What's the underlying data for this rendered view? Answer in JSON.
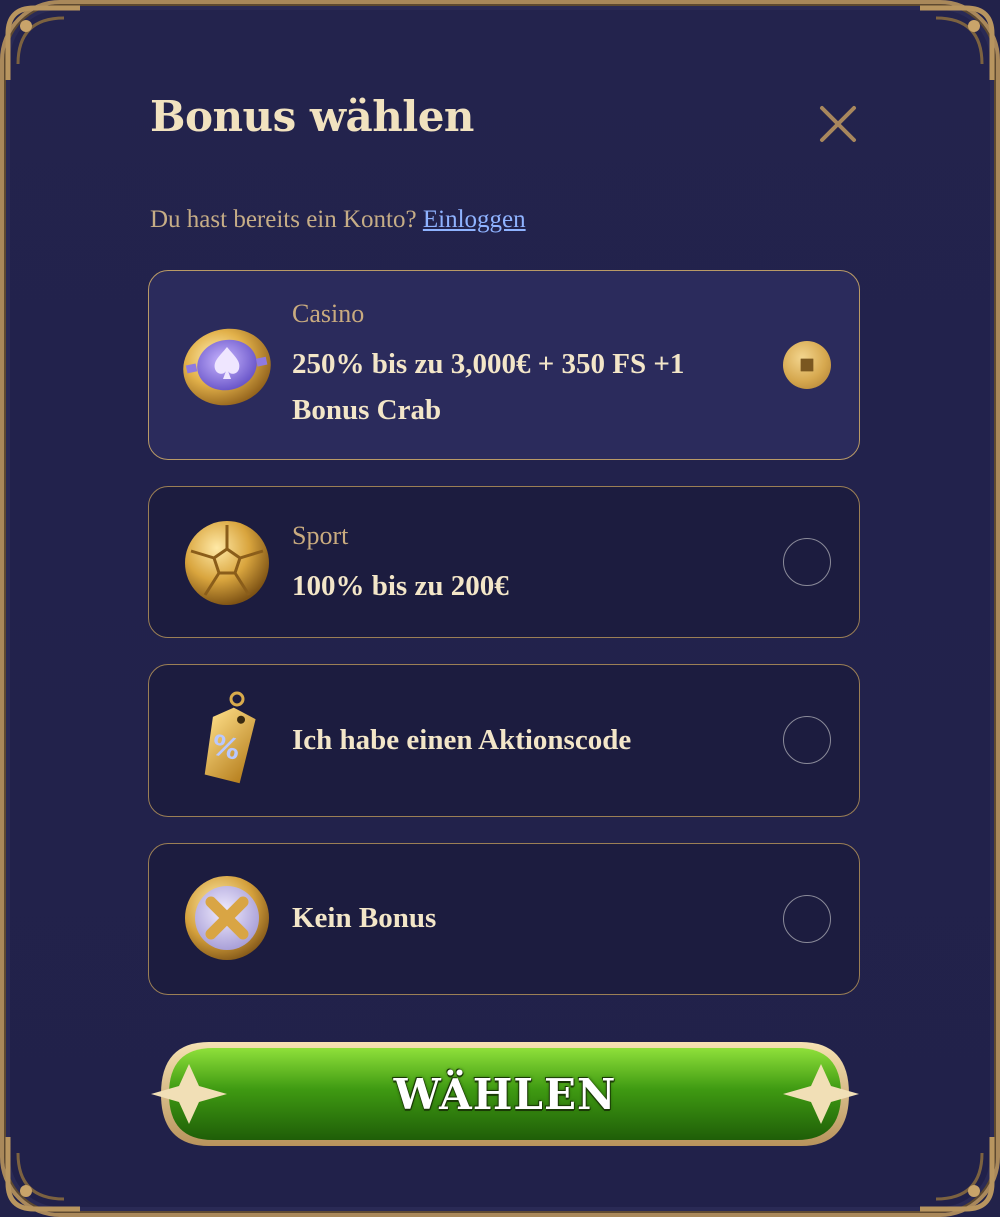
{
  "modal": {
    "title": "Bonus wählen",
    "close_icon": "close-icon"
  },
  "login": {
    "prompt": "Du hast bereits ein Konto?",
    "link_label": "Einloggen"
  },
  "options": [
    {
      "category": "Casino",
      "text": "250% bis zu 3,000€ + 350 FS +1 Bonus Crab",
      "icon": "casino-chip-icon",
      "selected": true
    },
    {
      "category": "Sport",
      "text": "100% bis zu 200€",
      "icon": "soccer-ball-icon",
      "selected": false
    },
    {
      "category": "",
      "text": "Ich habe einen Aktionscode",
      "icon": "promo-tag-icon",
      "selected": false
    },
    {
      "category": "",
      "text": "Kein Bonus",
      "icon": "no-bonus-icon",
      "selected": false
    }
  ],
  "cta": {
    "label": "WÄHLEN"
  },
  "colors": {
    "background": "#22224a",
    "gold": "#c9ab7f",
    "link": "#8fb3ff",
    "cta_green": "#3f9a12"
  }
}
